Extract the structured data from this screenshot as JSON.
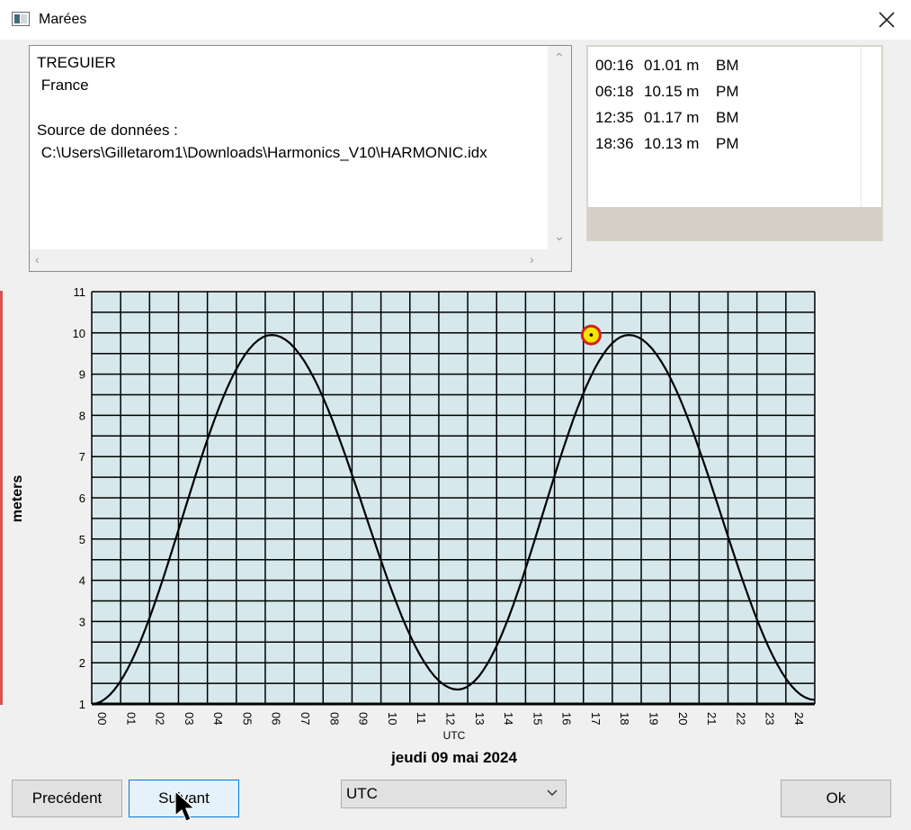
{
  "window": {
    "title": "Marées",
    "icon": "app-window-icon"
  },
  "info": {
    "station": "TREGUIER",
    "country": " France",
    "source_label": "Source de données :",
    "source_path": " C:\\Users\\Gilletarom1\\Downloads\\Harmonics_V10\\HARMONIC.idx"
  },
  "tides": [
    {
      "time": "00:16",
      "height": "01.01 m",
      "type": "BM"
    },
    {
      "time": "06:18",
      "height": "10.15 m",
      "type": "PM"
    },
    {
      "time": "12:35",
      "height": "01.17 m",
      "type": "BM"
    },
    {
      "time": "18:36",
      "height": "10.13 m",
      "type": "PM"
    }
  ],
  "chart_data": {
    "type": "line",
    "ylabel": "meters",
    "xlabel": "UTC",
    "date_label": "jeudi 09 mai 2024",
    "x_ticks": [
      "00",
      "01",
      "02",
      "03",
      "04",
      "05",
      "06",
      "07",
      "08",
      "09",
      "10",
      "11",
      "12",
      "13",
      "14",
      "15",
      "16",
      "17",
      "18",
      "19",
      "20",
      "21",
      "22",
      "23",
      "24"
    ],
    "y_ticks": [
      "1",
      "2",
      "3",
      "4",
      "5",
      "6",
      "7",
      "8",
      "9",
      "10",
      "11"
    ],
    "xlim": [
      0,
      24.9
    ],
    "ylim": [
      1,
      11
    ],
    "grid": true,
    "background": "#d6e8ec",
    "extrema": [
      {
        "time_h": 0.0,
        "height": 1.0
      },
      {
        "time_h": 6.2,
        "height": 9.95
      },
      {
        "time_h": 12.6,
        "height": 1.35
      },
      {
        "time_h": 18.5,
        "height": 9.95
      },
      {
        "time_h": 24.9,
        "height": 1.1
      }
    ],
    "current_marker": {
      "time_h": 17.2,
      "height": 9.95
    }
  },
  "buttons": {
    "previous": "Precédent",
    "next": "Suivant",
    "ok": "Ok"
  },
  "timezone": {
    "selected": "UTC"
  },
  "colors": {
    "marker_fill": "#f5e400",
    "marker_ring": "#d42020",
    "plot_bg": "#d6e8ec",
    "focus": "#0078d7"
  }
}
